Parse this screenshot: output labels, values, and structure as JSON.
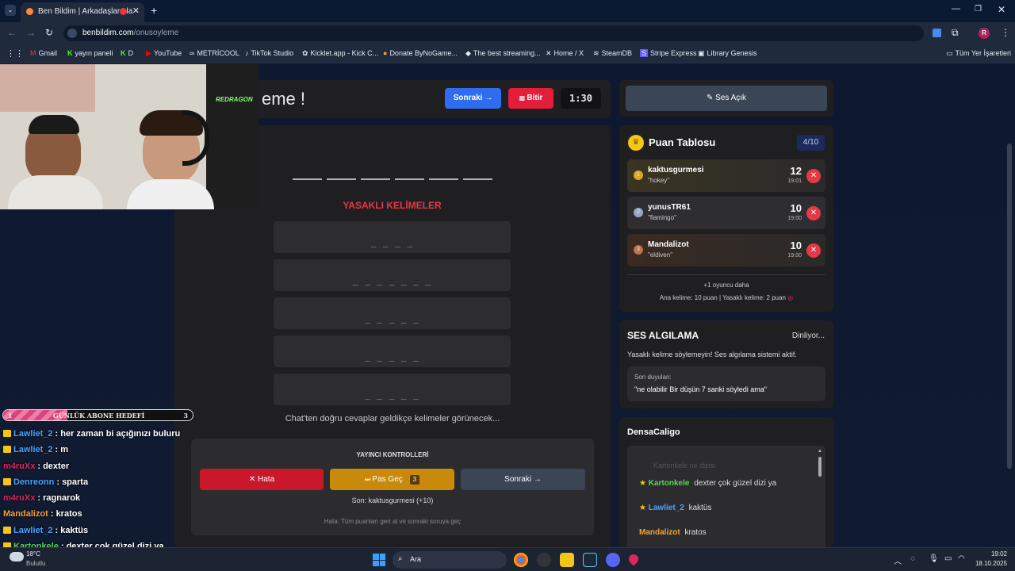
{
  "browser": {
    "tab_title": "Ben Bildim | Arkadaşlarınla",
    "url_domain": "benbildim.com",
    "url_path": "/onusoyleme",
    "bookmarks": [
      "Gmail",
      "yayın paneli",
      "D",
      "YouTube",
      "METRİCOOL",
      "TikTok Studio",
      "Kicklet.app - Kick C...",
      "Donate ByNoGame...",
      "The best streaming...",
      "Home / X",
      "SteamDB",
      "Stripe Express",
      "Library Genesis"
    ],
    "all_bookmarks": "Tüm Yer İşaretleri",
    "profile_initial": "R"
  },
  "game": {
    "title_partial": "eme !",
    "next_button": "Sonraki →",
    "finish_button": "Bitir",
    "timer": "1:30",
    "forbidden_title": "YASAKLI KELİMELER",
    "forbidden_words": [
      "_ _ _ _",
      "_ _ _ _ _ _ _",
      "_ _ _ _ _",
      "_ _ _ _ _",
      "_ _ _ _ _"
    ],
    "hint_text": "Chat'ten doğru cevaplar geldikçe kelimeler görünecek...",
    "controls_title": "YAYINCI KONTROLLERİ",
    "error_button": "Hata",
    "pass_button": "Pas Geç",
    "pass_count": "3",
    "next_button2": "Sonraki →",
    "last_status": "Son: kaktusgurmesi (+10)",
    "error_hint": "Hata: Tüm puanları geri al ve sonraki soruya geç"
  },
  "sound_button": "Ses Açık",
  "scoreboard": {
    "title": "Puan Tablosu",
    "badge": "4/10",
    "entries": [
      {
        "name": "kaktusgurmesi",
        "word": "\"hokey\"",
        "points": "12",
        "time": "19:01"
      },
      {
        "name": "yunusTR61",
        "word": "\"flamingo\"",
        "points": "10",
        "time": "19:00"
      },
      {
        "name": "Mandalizot",
        "word": "\"eldiven\"",
        "points": "10",
        "time": "19:00"
      }
    ],
    "more_players": "+1 oyuncu daha",
    "rules": "Ana kelime: 10 puan | Yasaklı kelime: 2 puan"
  },
  "sound_detect": {
    "title": "SES ALGILAMA",
    "status": "Dinliyor...",
    "description": "Yasaklı kelime söylemeyin! Ses algılama sistemi aktif.",
    "last_heard_label": "Son duyulan:",
    "last_heard": "\"ne olabilir Bir düşün 7 sanki söyledi ama\""
  },
  "chat_panel": {
    "title": "DensaCaligo",
    "faded": "Kartonkele  ne dizisi",
    "messages": [
      {
        "user": "Kartonkele",
        "text": "dexter çok güzel dizi ya",
        "color": "#5fd35f"
      },
      {
        "user": "Lawliet_2",
        "text": "kaktüs",
        "color": "#4aa3ff"
      },
      {
        "user": "Mandalizot",
        "text": "kratos",
        "color": "#f0a040"
      }
    ]
  },
  "overlay": {
    "goal_label": "GÜNLÜK ABONE HEDEFİ",
    "goal_left": "1",
    "goal_right": "3",
    "webcam_brand": "REDRAGON",
    "chat": [
      {
        "user": "Lawliet_2",
        "text": ": her zaman bi açığınızı buluru",
        "color": "#4aa3ff",
        "crown": true
      },
      {
        "user": "Lawliet_2",
        "text": ": m",
        "color": "#4aa3ff",
        "crown": true
      },
      {
        "user": "m4ruXx",
        "text": ": dexter",
        "color": "#e0245e",
        "crown": false
      },
      {
        "user": "Denreonn",
        "text": ": sparta",
        "color": "#4aa3ff",
        "crown": true
      },
      {
        "user": "m4ruXx",
        "text": ": ragnarok",
        "color": "#e0245e",
        "crown": false
      },
      {
        "user": "Mandalizot",
        "text": ": kratos",
        "color": "#f0a040",
        "crown": false
      },
      {
        "user": "Lawliet_2",
        "text": ": kaktüs",
        "color": "#4aa3ff",
        "crown": true
      },
      {
        "user": "Kartonkele",
        "text": ": dexter çok güzel dizi ya",
        "color": "#5fd35f",
        "crown": true
      }
    ]
  },
  "taskbar": {
    "weather_temp": "18°C",
    "weather_desc": "Bulutlu",
    "search": "Ara",
    "time": "19:02",
    "date": "18.10.2025"
  }
}
